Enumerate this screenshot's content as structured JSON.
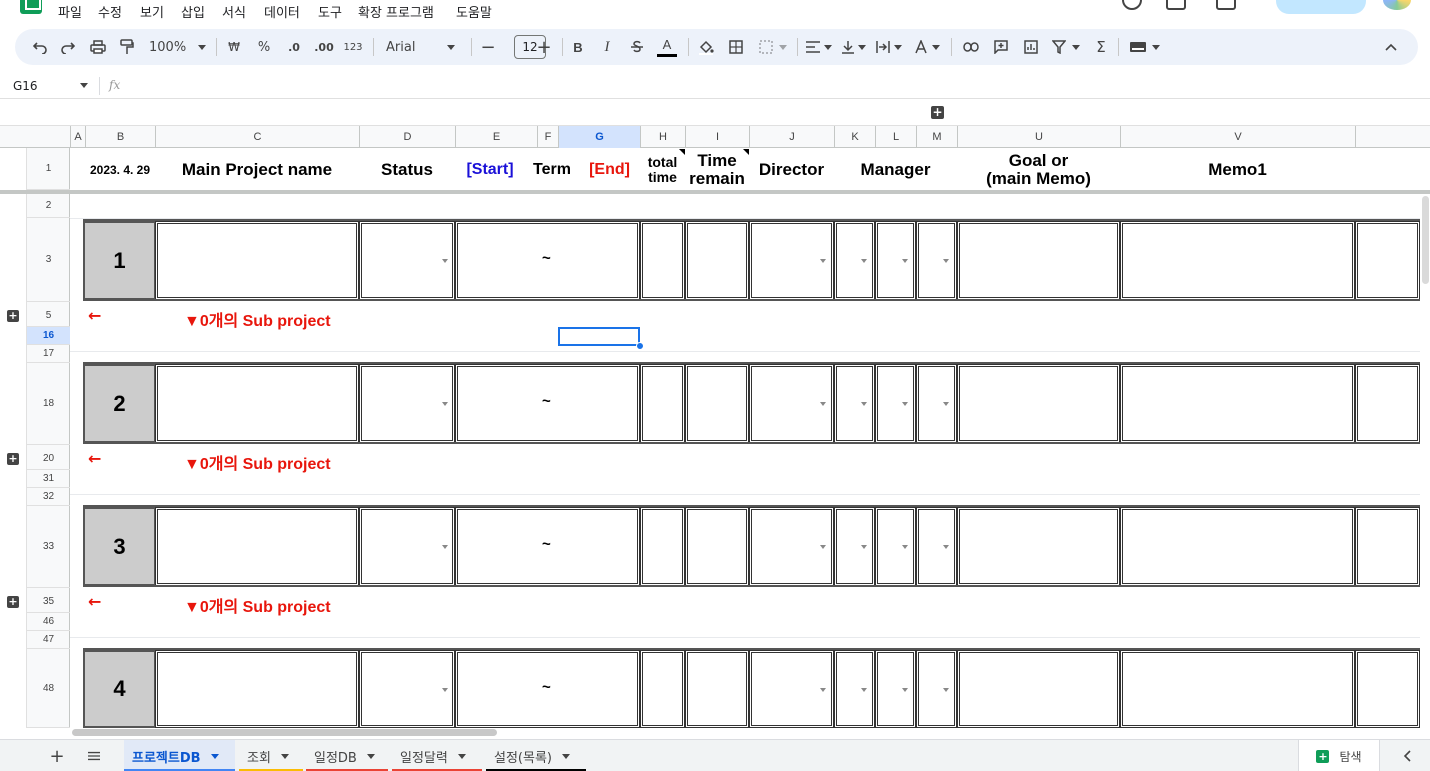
{
  "menu": [
    "파일",
    "수정",
    "보기",
    "삽입",
    "서식",
    "데이터",
    "도구",
    "확장 프로그램",
    "도움말"
  ],
  "toolbar": {
    "zoom": "100%",
    "currency": "₩",
    "percent": "%",
    "decimal_decrease": ".0",
    "decimal_increase": ".00",
    "number_format": "123",
    "font": "Arial",
    "font_size": "12",
    "bold": "B",
    "italic": "I",
    "text_color_letter": "A"
  },
  "formula_bar": {
    "cell_ref": "G16",
    "fx": "fx",
    "value": ""
  },
  "columns": [
    "A",
    "B",
    "C",
    "D",
    "E",
    "F",
    "G",
    "H",
    "I",
    "J",
    "K",
    "L",
    "M",
    "U",
    "V"
  ],
  "selected_column": "G",
  "header_row": {
    "row_number": "1",
    "date": "2023. 4. 29",
    "project_name": "Main Project name",
    "status": "Status",
    "start": "[Start]",
    "term": "Term",
    "end": "[End]",
    "total_time_1": "total",
    "total_time_2": "time",
    "time_remain_1": "Time",
    "time_remain_2": "remain",
    "director": "Director",
    "manager": "Manager",
    "goal_1": "Goal or",
    "goal_2": "(main Memo)",
    "memo": "Memo1"
  },
  "row_numbers": [
    "2",
    "3",
    "5",
    "16",
    "17",
    "18",
    "20",
    "31",
    "32",
    "33",
    "35",
    "46",
    "47",
    "48"
  ],
  "selected_row": "16",
  "projects": [
    {
      "number": "1",
      "term": "~",
      "arrow": "←",
      "sub_label": "▼0개의 Sub project"
    },
    {
      "number": "2",
      "term": "~",
      "arrow": "←",
      "sub_label": "▼0개의 Sub project"
    },
    {
      "number": "3",
      "term": "~",
      "arrow": "←",
      "sub_label": "▼0개의 Sub project"
    },
    {
      "number": "4",
      "term": "~"
    }
  ],
  "sheet_tabs": [
    {
      "label": "프로젝트DB",
      "active": true,
      "underline": "#4285f4"
    },
    {
      "label": "조회",
      "active": false,
      "underline": "#fbbc04"
    },
    {
      "label": "일정DB",
      "active": false,
      "underline": "#ea4335"
    },
    {
      "label": "일정달력",
      "active": false,
      "underline": "#ea4335"
    },
    {
      "label": "설정(목록)",
      "active": false,
      "underline": "#000000"
    }
  ],
  "explore_label": "탐색",
  "colors": {
    "accent": "#0b57d0",
    "red_text": "#e8160c",
    "blue_text": "#1a10d8",
    "project_fill": "#cccccc",
    "selection": "#1a73e8"
  }
}
